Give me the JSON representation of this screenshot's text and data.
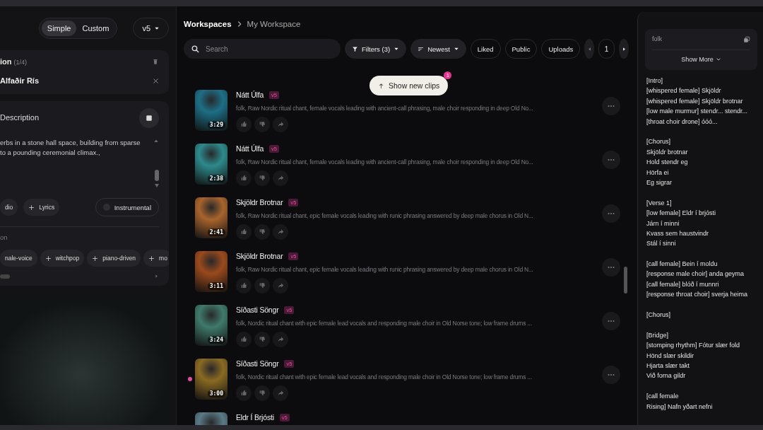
{
  "left_panel": {
    "mode_tabs": [
      {
        "label": "Simple",
        "selected": true
      },
      {
        "label": "Custom",
        "selected": false
      }
    ],
    "model": "v5",
    "inspiration": {
      "title": "ion",
      "count": "(1/4)",
      "item": "Alfaðir Rís"
    },
    "description": {
      "title": "Description",
      "text": "erbs in a stone hall space, building from sparse\nto a pounding ceremonial climax.,"
    },
    "toggles": [
      {
        "label": "dio",
        "kind": "chip"
      },
      {
        "label": "Lyrics",
        "kind": "add"
      },
      {
        "label": "Instrumental",
        "kind": "switch",
        "on": false
      }
    ],
    "section_label": "on",
    "tags": [
      "nale-voice",
      "witchpop",
      "piano-driven",
      "mo"
    ]
  },
  "breadcrumb": [
    "Workspaces",
    "My Workspace"
  ],
  "toolbar": {
    "search_placeholder": "Search",
    "filters": "Filters (3)",
    "sort": "Newest",
    "chips": [
      "Liked",
      "Public",
      "Uploads"
    ],
    "page": "1"
  },
  "new_clips": {
    "label": "Show new clips",
    "badge": "1"
  },
  "clips": [
    {
      "title": "Nátt Úlfa",
      "version": "v5",
      "description": "folk, Raw Nordic ritual chant, female vocals leading with ancient-call phrasing, male choir responding in deep Old No...",
      "duration": "3:29",
      "color": "#1d6f86",
      "playing": false
    },
    {
      "title": "Nátt Úlfa",
      "version": "v5",
      "description": "folk, Raw Nordic ritual chant, female vocals leading with ancient-call phrasing, male choir responding in deep Old No...",
      "duration": "2:38",
      "color": "#2d8a8c",
      "playing": false
    },
    {
      "title": "Skjöldr Brotnar",
      "version": "v5",
      "description": "folk, Raw Nordic ritual chant, epic female vocals leading with runic phrasing answered by deep male chorus in Old N...",
      "duration": "2:41",
      "color": "#a8642c",
      "playing": false
    },
    {
      "title": "Skjöldr Brotnar",
      "version": "v5",
      "description": "folk, Raw Nordic ritual chant, epic female vocals leading with runic phrasing answered by deep male chorus in Old N...",
      "duration": "3:11",
      "color": "#9a4a1c",
      "playing": false
    },
    {
      "title": "Síðasti Söngr",
      "version": "v5",
      "description": "folk, Nordic ritual chant with epic female lead vocals and responding male choir in Old Norse tone; low frame drums ...",
      "duration": "3:24",
      "color": "#3f7a6a",
      "playing": false
    },
    {
      "title": "Síðasti Söngr",
      "version": "v5",
      "description": "folk, Nordic ritual chant with epic female lead vocals and responding male choir in Old Norse tone; low frame drums ...",
      "duration": "3:00",
      "color": "#8a6a22",
      "playing": true
    },
    {
      "title": "Eldr Í Brjósti",
      "version": "v5",
      "color": "#5a7a86",
      "playing": false
    }
  ],
  "details": {
    "style": "folk",
    "show_more": "Show More",
    "lyrics": [
      [
        "[Intro]",
        "[whispered female] Skjöldr",
        "[whispered female] Skjöldr brotnar",
        "[low male murmur] stendr... stendr...",
        "[throat choir drone] óóó..."
      ],
      [
        "[Chorus]",
        "Skjöldr brotnar",
        "Hold stendr eg",
        "Hörfa ei",
        "Eg sigrar"
      ],
      [
        "[Verse 1]",
        "[low female] Eldr í brjósti",
        "Járn í minni",
        "Kvass sem haustvindr",
        "Stál í sinni"
      ],
      [
        "[call female] Bein í moldu",
        "[response male choir] anda geyma",
        "[call female] blóð í munnri",
        "[response throat choir] sverja heima"
      ],
      [
        "[Chorus]"
      ],
      [
        "[Bridge]",
        "[stomping rhythm] Fótur slær fold",
        "Hönd slær skildir",
        "Hjarta slær takt",
        "Við forna gildr"
      ],
      [
        "[call female",
        "Rising] Nafn yðart nefni"
      ]
    ]
  }
}
